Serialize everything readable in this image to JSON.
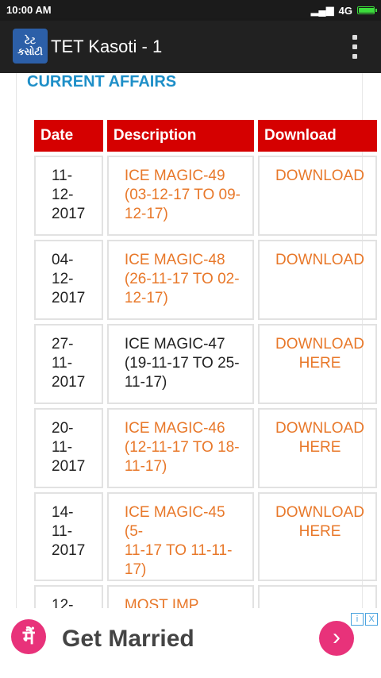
{
  "status_bar": {
    "time": "10:00 AM",
    "network": "4G",
    "battery_level": 1.0
  },
  "app_bar": {
    "logo_line1": "ટેટ",
    "logo_line2": "કસોટી",
    "title": "TET Kasoti - 1"
  },
  "page": {
    "heading": "CURRENT AFFAIRS",
    "table": {
      "headers": [
        "Date",
        "Description",
        "Download"
      ],
      "rows": [
        {
          "date": [
            "11-",
            "12-",
            "2017"
          ],
          "description": [
            "ICE MAGIC-49",
            "(03-12-17 TO 09-",
            "12-17)"
          ],
          "download": [
            "DOWNLOAD",
            ""
          ],
          "desc_is_link": true
        },
        {
          "date": [
            "04-",
            "12-",
            "2017"
          ],
          "description": [
            "ICE MAGIC-48",
            "(26-11-17 TO 02-",
            "12-17)"
          ],
          "download": [
            "DOWNLOAD",
            ""
          ],
          "desc_is_link": true
        },
        {
          "date": [
            "27-",
            "11-",
            "2017"
          ],
          "description": [
            "ICE MAGIC-47",
            "(19-11-17 TO 25-",
            "11-17)"
          ],
          "download": [
            "DOWNLOAD",
            "HERE"
          ],
          "desc_is_link": false
        },
        {
          "date": [
            "20-",
            "11-",
            "2017"
          ],
          "description": [
            "ICE MAGIC-46",
            "(12-11-17 TO 18-",
            "11-17)"
          ],
          "download": [
            "DOWNLOAD",
            "HERE"
          ],
          "desc_is_link": true
        },
        {
          "date": [
            "14-",
            "11-",
            "2017"
          ],
          "description": [
            "ICE MAGIC-45 (5-",
            "11-17 TO 11-11-",
            "17)"
          ],
          "download": [
            "DOWNLOAD",
            "HERE"
          ],
          "desc_is_link": true
        },
        {
          "date": [
            "12-",
            "",
            ""
          ],
          "description": [
            "MOST IMP",
            "",
            ""
          ],
          "download": [
            "",
            ""
          ],
          "desc_is_link": true
        }
      ]
    }
  },
  "ad": {
    "info_icon": "i",
    "close_icon": "X",
    "logo": "मैं",
    "text": "Get Married",
    "go_icon": "chevron-right-icon",
    "go_glyph": "›"
  },
  "colors": {
    "header_red": "#d50000",
    "link_orange": "#e8782a",
    "heading_blue": "#1e8fc8",
    "app_bar": "#212121",
    "ad_pink": "#e8327a"
  }
}
